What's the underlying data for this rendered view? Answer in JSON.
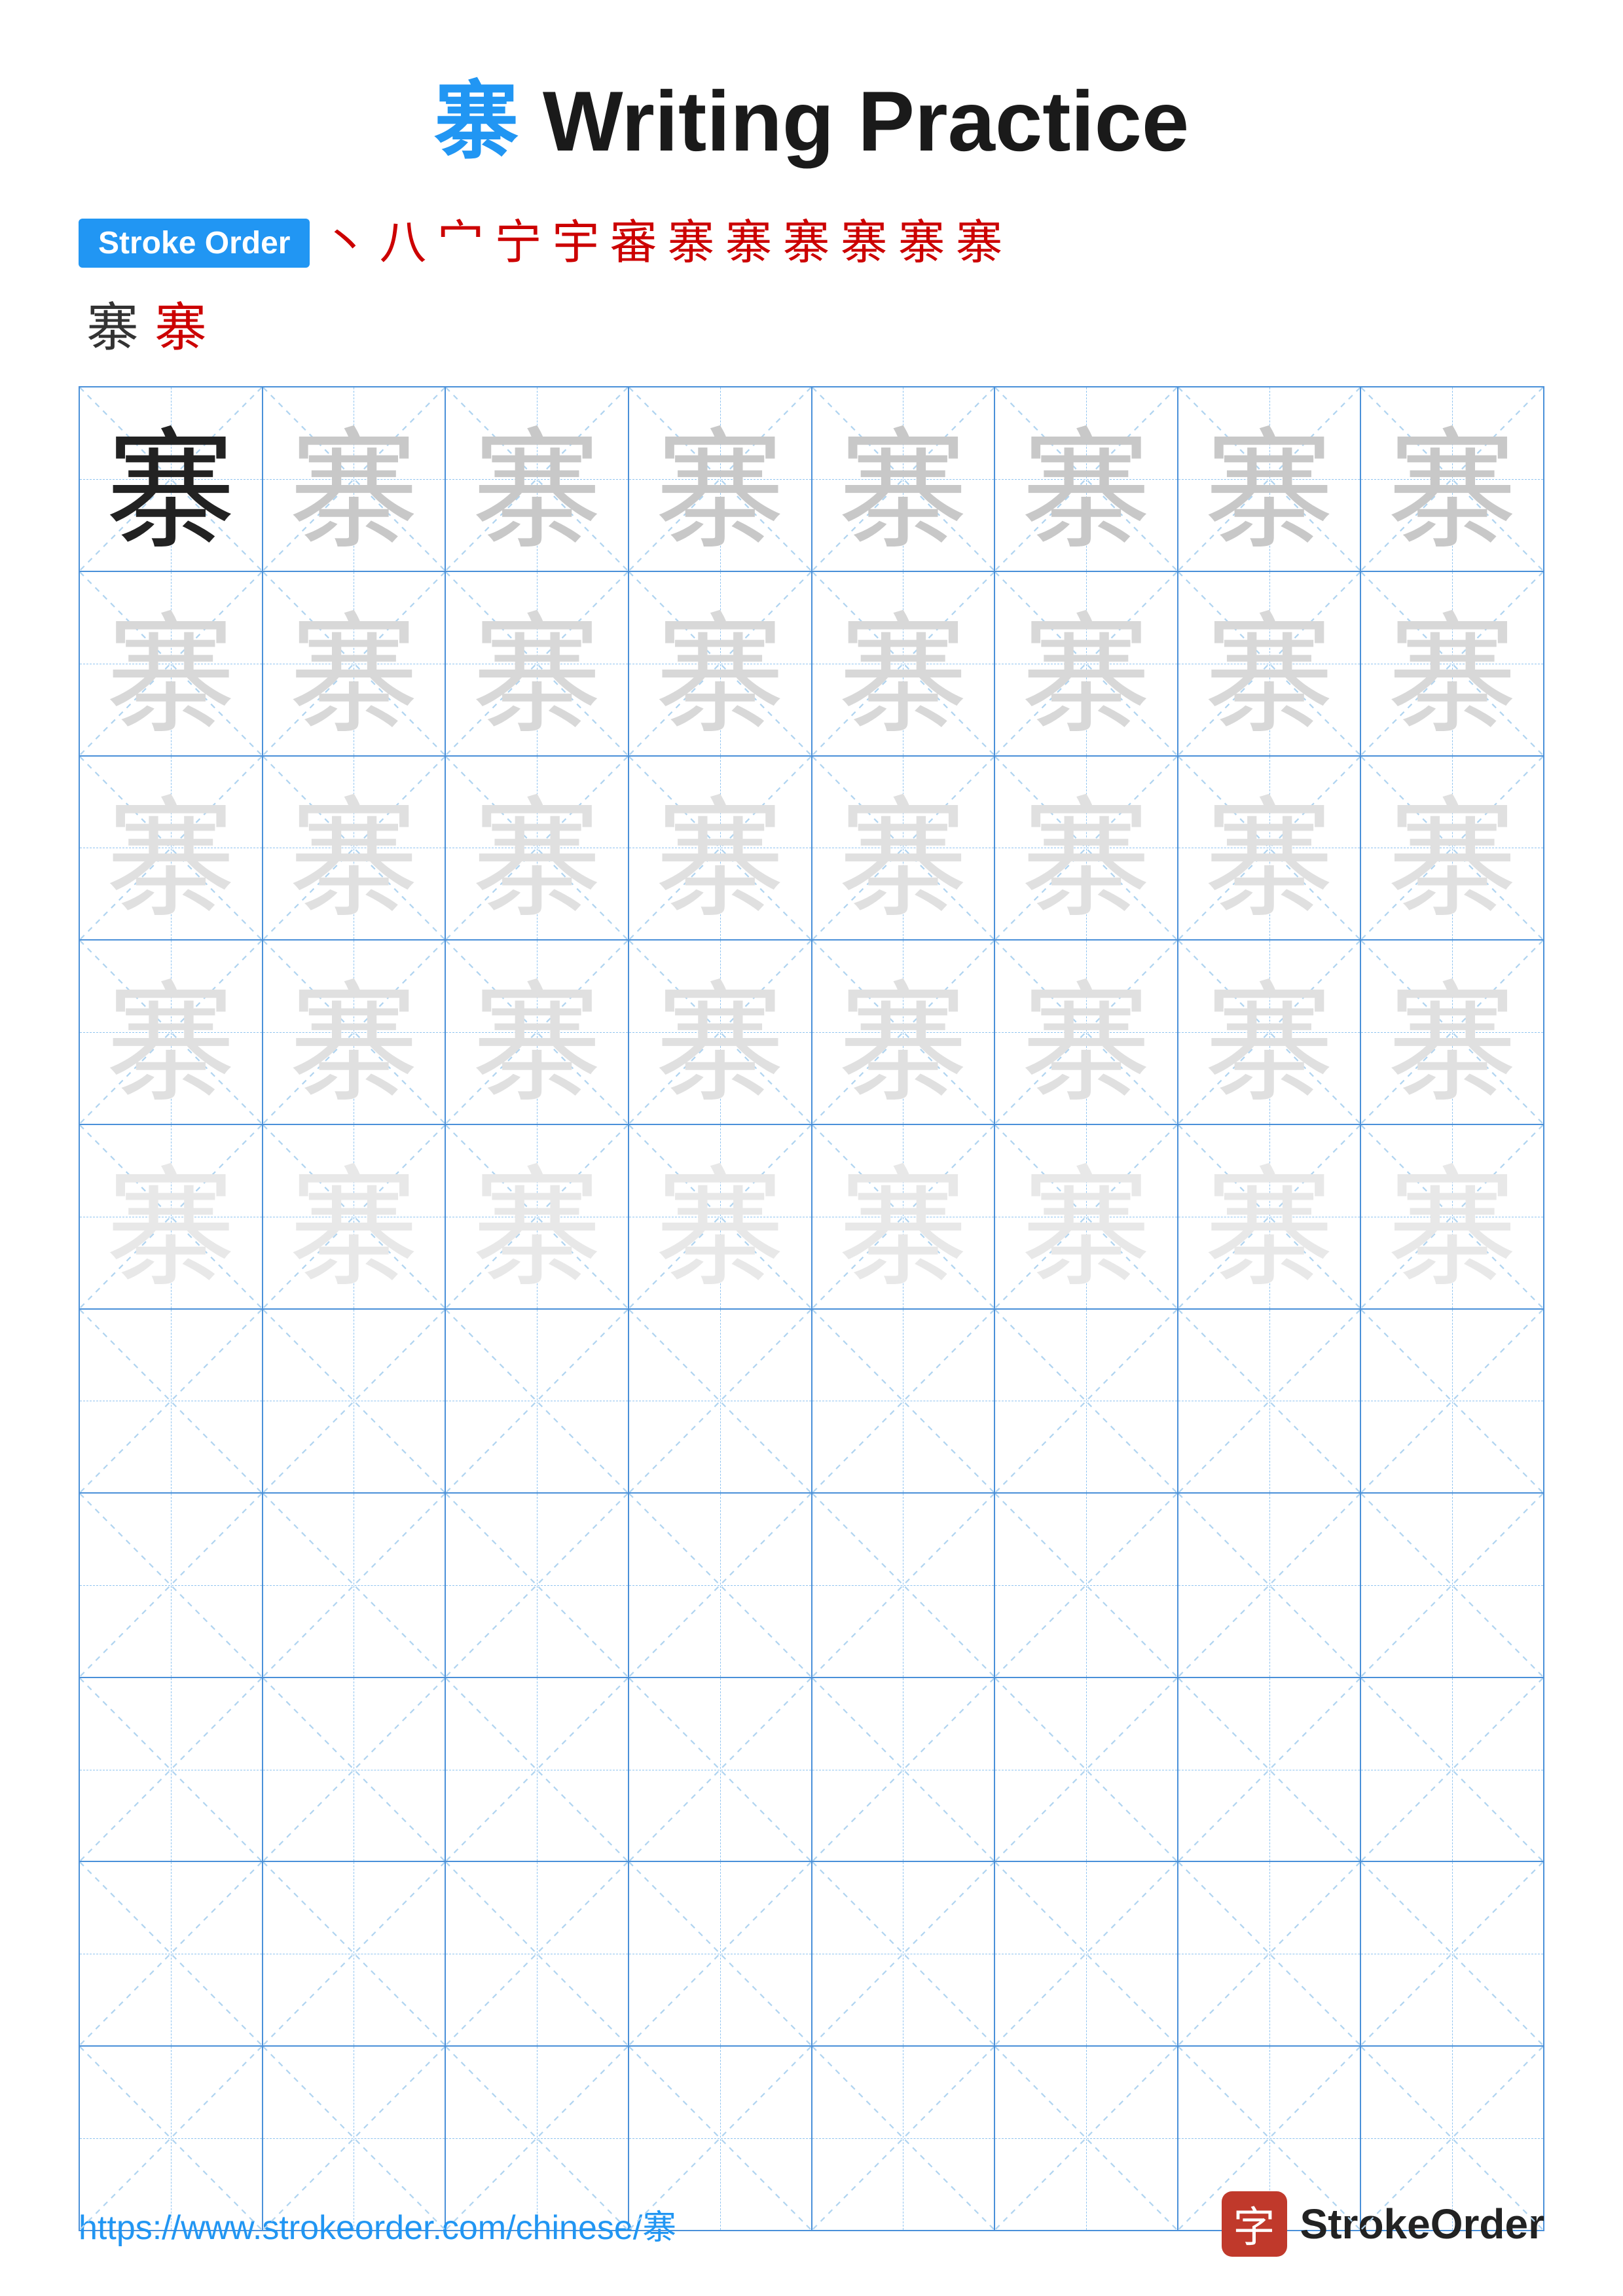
{
  "title": {
    "char": "寨",
    "text": " Writing Practice"
  },
  "stroke_order": {
    "badge_label": "Stroke Order",
    "strokes": [
      "丶",
      "八",
      "宀",
      "宀",
      "宁",
      "宇",
      "審",
      "寨",
      "寨",
      "寨",
      "寨",
      "寨",
      "寨",
      "寨"
    ]
  },
  "practice": {
    "char": "寨",
    "rows": 10,
    "cols": 8
  },
  "footer": {
    "url": "https://www.strokeorder.com/chinese/寨",
    "logo_char": "字",
    "brand_name": "StrokeOrder"
  }
}
